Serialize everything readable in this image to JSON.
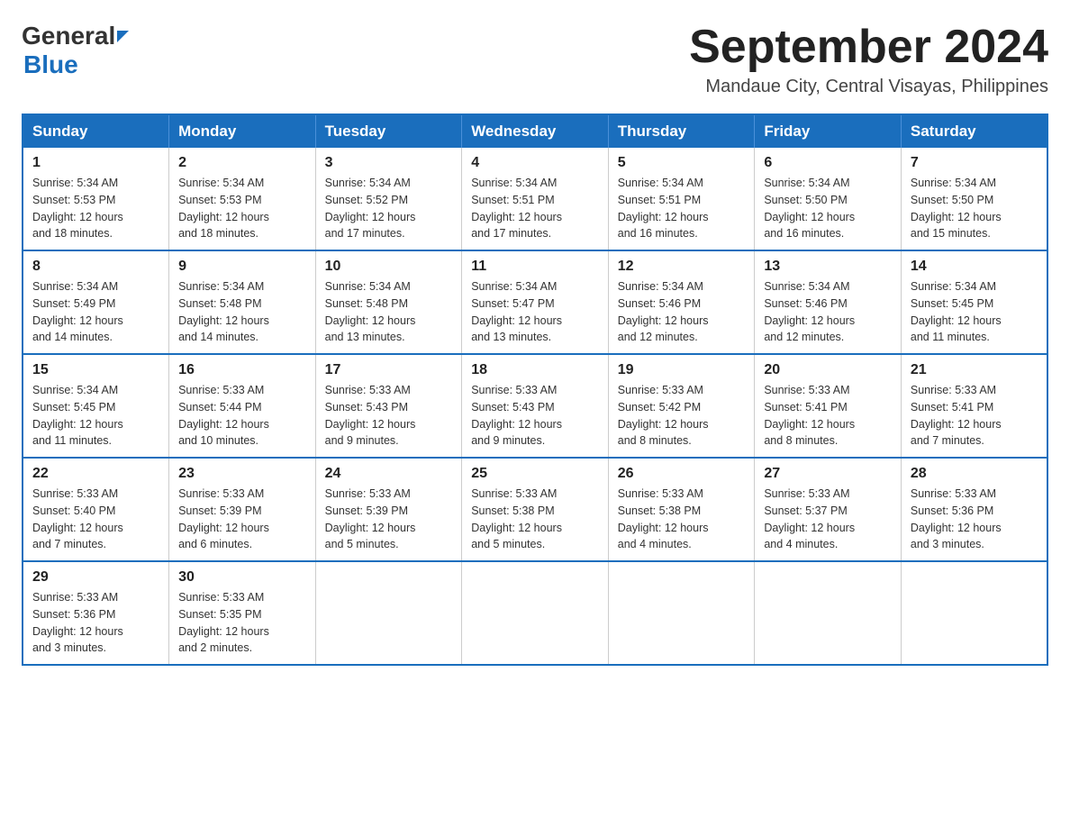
{
  "header": {
    "logo_general": "General",
    "logo_blue": "Blue",
    "month_title": "September 2024",
    "subtitle": "Mandaue City, Central Visayas, Philippines"
  },
  "weekdays": [
    "Sunday",
    "Monday",
    "Tuesday",
    "Wednesday",
    "Thursday",
    "Friday",
    "Saturday"
  ],
  "weeks": [
    [
      {
        "day": "1",
        "sunrise": "5:34 AM",
        "sunset": "5:53 PM",
        "daylight": "12 hours and 18 minutes."
      },
      {
        "day": "2",
        "sunrise": "5:34 AM",
        "sunset": "5:53 PM",
        "daylight": "12 hours and 18 minutes."
      },
      {
        "day": "3",
        "sunrise": "5:34 AM",
        "sunset": "5:52 PM",
        "daylight": "12 hours and 17 minutes."
      },
      {
        "day": "4",
        "sunrise": "5:34 AM",
        "sunset": "5:51 PM",
        "daylight": "12 hours and 17 minutes."
      },
      {
        "day": "5",
        "sunrise": "5:34 AM",
        "sunset": "5:51 PM",
        "daylight": "12 hours and 16 minutes."
      },
      {
        "day": "6",
        "sunrise": "5:34 AM",
        "sunset": "5:50 PM",
        "daylight": "12 hours and 16 minutes."
      },
      {
        "day": "7",
        "sunrise": "5:34 AM",
        "sunset": "5:50 PM",
        "daylight": "12 hours and 15 minutes."
      }
    ],
    [
      {
        "day": "8",
        "sunrise": "5:34 AM",
        "sunset": "5:49 PM",
        "daylight": "12 hours and 14 minutes."
      },
      {
        "day": "9",
        "sunrise": "5:34 AM",
        "sunset": "5:48 PM",
        "daylight": "12 hours and 14 minutes."
      },
      {
        "day": "10",
        "sunrise": "5:34 AM",
        "sunset": "5:48 PM",
        "daylight": "12 hours and 13 minutes."
      },
      {
        "day": "11",
        "sunrise": "5:34 AM",
        "sunset": "5:47 PM",
        "daylight": "12 hours and 13 minutes."
      },
      {
        "day": "12",
        "sunrise": "5:34 AM",
        "sunset": "5:46 PM",
        "daylight": "12 hours and 12 minutes."
      },
      {
        "day": "13",
        "sunrise": "5:34 AM",
        "sunset": "5:46 PM",
        "daylight": "12 hours and 12 minutes."
      },
      {
        "day": "14",
        "sunrise": "5:34 AM",
        "sunset": "5:45 PM",
        "daylight": "12 hours and 11 minutes."
      }
    ],
    [
      {
        "day": "15",
        "sunrise": "5:34 AM",
        "sunset": "5:45 PM",
        "daylight": "12 hours and 11 minutes."
      },
      {
        "day": "16",
        "sunrise": "5:33 AM",
        "sunset": "5:44 PM",
        "daylight": "12 hours and 10 minutes."
      },
      {
        "day": "17",
        "sunrise": "5:33 AM",
        "sunset": "5:43 PM",
        "daylight": "12 hours and 9 minutes."
      },
      {
        "day": "18",
        "sunrise": "5:33 AM",
        "sunset": "5:43 PM",
        "daylight": "12 hours and 9 minutes."
      },
      {
        "day": "19",
        "sunrise": "5:33 AM",
        "sunset": "5:42 PM",
        "daylight": "12 hours and 8 minutes."
      },
      {
        "day": "20",
        "sunrise": "5:33 AM",
        "sunset": "5:41 PM",
        "daylight": "12 hours and 8 minutes."
      },
      {
        "day": "21",
        "sunrise": "5:33 AM",
        "sunset": "5:41 PM",
        "daylight": "12 hours and 7 minutes."
      }
    ],
    [
      {
        "day": "22",
        "sunrise": "5:33 AM",
        "sunset": "5:40 PM",
        "daylight": "12 hours and 7 minutes."
      },
      {
        "day": "23",
        "sunrise": "5:33 AM",
        "sunset": "5:39 PM",
        "daylight": "12 hours and 6 minutes."
      },
      {
        "day": "24",
        "sunrise": "5:33 AM",
        "sunset": "5:39 PM",
        "daylight": "12 hours and 5 minutes."
      },
      {
        "day": "25",
        "sunrise": "5:33 AM",
        "sunset": "5:38 PM",
        "daylight": "12 hours and 5 minutes."
      },
      {
        "day": "26",
        "sunrise": "5:33 AM",
        "sunset": "5:38 PM",
        "daylight": "12 hours and 4 minutes."
      },
      {
        "day": "27",
        "sunrise": "5:33 AM",
        "sunset": "5:37 PM",
        "daylight": "12 hours and 4 minutes."
      },
      {
        "day": "28",
        "sunrise": "5:33 AM",
        "sunset": "5:36 PM",
        "daylight": "12 hours and 3 minutes."
      }
    ],
    [
      {
        "day": "29",
        "sunrise": "5:33 AM",
        "sunset": "5:36 PM",
        "daylight": "12 hours and 3 minutes."
      },
      {
        "day": "30",
        "sunrise": "5:33 AM",
        "sunset": "5:35 PM",
        "daylight": "12 hours and 2 minutes."
      },
      null,
      null,
      null,
      null,
      null
    ]
  ]
}
